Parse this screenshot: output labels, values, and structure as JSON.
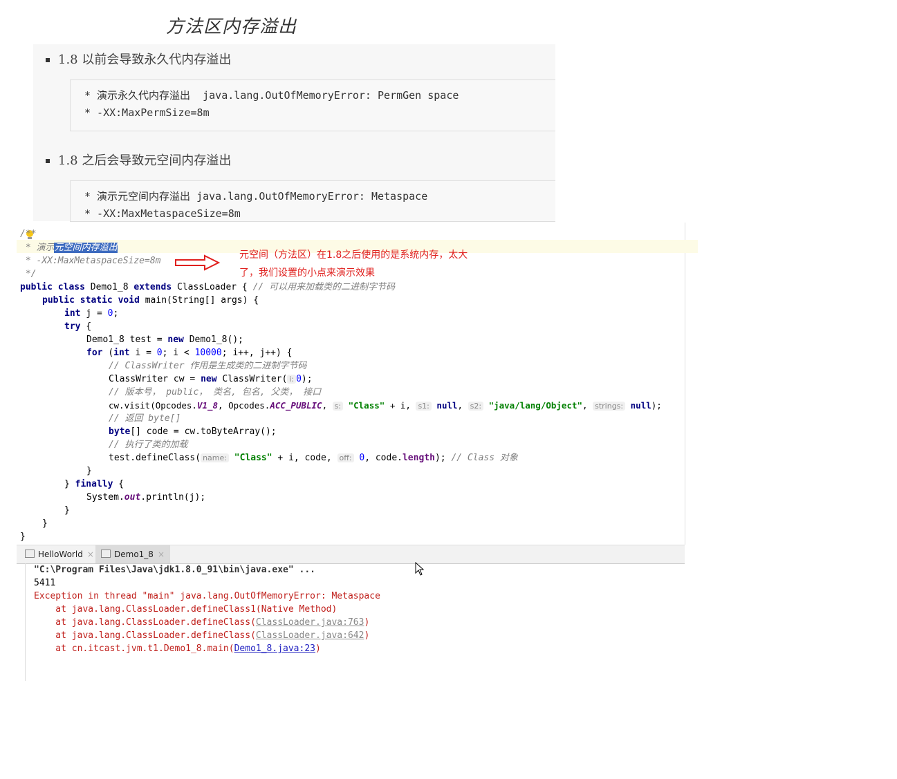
{
  "page_title": "方法区内存溢出",
  "notes": {
    "bullet1": "1.8 以前会导致永久代内存溢出",
    "box1": [
      "* 演示永久代内存溢出  java.lang.OutOfMemoryError: PermGen space",
      "* -XX:MaxPermSize=8m"
    ],
    "bullet2": "1.8 之后会导致元空间内存溢出",
    "box2": [
      "* 演示元空间内存溢出 java.lang.OutOfMemoryError: Metaspace",
      "* -XX:MaxMetaspaceSize=8m"
    ]
  },
  "editor": {
    "c0": "/**",
    "c1a": " * 演示",
    "c1b": "元空间内存溢出",
    "c2": " * -XX:MaxMetaspaceSize=8m",
    "c3": " */",
    "l1": {
      "kw": "public class ",
      "name": "Demo1_8 ",
      "kw2": "extends ",
      "sup": "ClassLoader { ",
      "cm": "// 可以用来加载类的二进制字节码"
    },
    "l2": {
      "kw": "public static void ",
      "rest": "main(String[] args) {"
    },
    "l3": {
      "kw": "int ",
      "a": "j = ",
      "n": "0",
      "b": ";"
    },
    "l4": {
      "kw": "try ",
      "rest": "{"
    },
    "l5": {
      "a": "Demo1_8 test = ",
      "kw": "new ",
      "b": "Demo1_8();"
    },
    "l6": {
      "kw": "for ",
      "a": "(",
      "kw2": "int ",
      "b": "i = ",
      "n1": "0",
      "c": "; i < ",
      "n2": "10000",
      "d": "; i++, j++) {"
    },
    "l7": "// ClassWriter 作用是生成类的二进制字节码",
    "l8": {
      "a": "ClassWriter cw = ",
      "kw": "new ",
      "b": "ClassWriter(",
      "h": "i:",
      "n": "0",
      "c": ");"
    },
    "l9": "// 版本号， public， 类名, 包名, 父类， 接口",
    "l10": {
      "a": "cw.visit(Opcodes.",
      "f1": "V1_8",
      "b": ", Opcodes.",
      "f2": "ACC_PUBLIC",
      "c": ", ",
      "h1": "s:",
      "s1": "\"Class\"",
      "d": " + i, ",
      "h2": "s1:",
      "kw1": "null",
      "e": ", ",
      "h3": "s2:",
      "s2": "\"java/lang/Object\"",
      "f": ", ",
      "h4": "strings:",
      "kw2": "null",
      "g": ");"
    },
    "l11": "// 返回 byte[]",
    "l12": {
      "kw": "byte",
      "rest": "[] code = cw.toByteArray();"
    },
    "l13": "// 执行了类的加载",
    "l14": {
      "a": "test.defineClass(",
      "h1": "name:",
      "s": "\"Class\"",
      "b": " + i, code, ",
      "h2": "off:",
      "n": "0",
      "c": ", code.",
      "f": "length",
      "d": "); ",
      "cm": "// Class 对象"
    },
    "l15": "}",
    "l16": {
      "a": "} ",
      "kw": "finally ",
      "b": "{"
    },
    "l17": {
      "a": "System.",
      "f": "out",
      "b": ".println(j);"
    },
    "l18": "}",
    "l19": "}",
    "l20": "}"
  },
  "annotation": {
    "line1": "元空间（方法区）在1.8之后使用的是系统内存，太大",
    "line2": "了，我们设置的小点来演示效果"
  },
  "run_tabs": [
    {
      "label": "HelloWorld"
    },
    {
      "label": "Demo1_8"
    }
  ],
  "tab_close": "×",
  "console": {
    "cmd": "\"C:\\Program Files\\Java\\jdk1.8.0_91\\bin\\java.exe\" ...",
    "out": "5411",
    "err1": "Exception in thread \"main\" java.lang.OutOfMemoryError: Metaspace",
    "err2": "    at java.lang.ClassLoader.defineClass1(Native Method)",
    "err3a": "    at java.lang.ClassLoader.defineClass(",
    "err3b": "ClassLoader.java:763",
    "err3c": ")",
    "err4a": "    at java.lang.ClassLoader.defineClass(",
    "err4b": "ClassLoader.java:642",
    "err4c": ")",
    "err5a": "    at cn.itcast.jvm.t1.Demo1_8.main(",
    "err5b": "Demo1_8.java:23",
    "err5c": ")"
  },
  "colors": {
    "annotation": "#e0201e",
    "keyword": "#000080",
    "string": "#008000",
    "error": "#c0201c"
  }
}
